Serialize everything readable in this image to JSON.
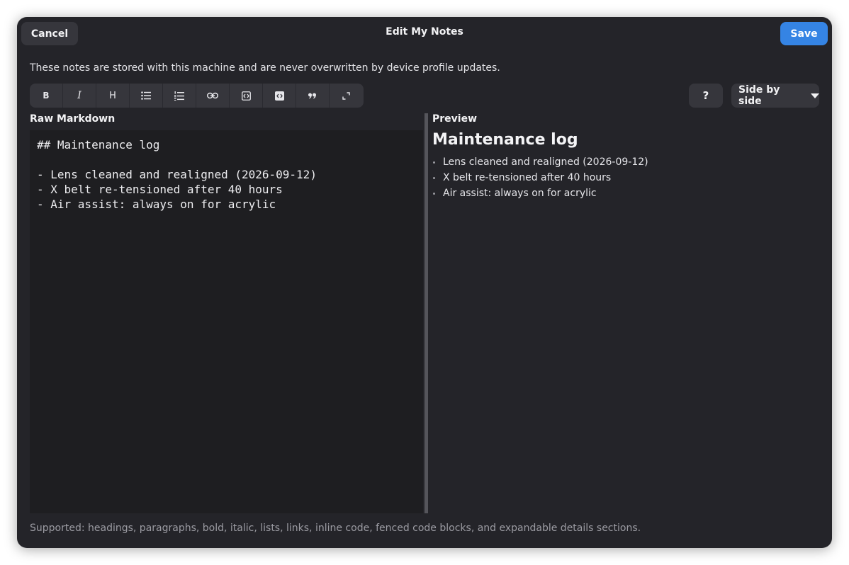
{
  "header": {
    "cancel_label": "Cancel",
    "title": "Edit My Notes",
    "save_label": "Save"
  },
  "description": "These notes are stored with this machine and are never overwritten by device profile updates.",
  "toolbar": {
    "buttons": [
      {
        "icon": "bold-icon",
        "glyph": "B"
      },
      {
        "icon": "italic-icon",
        "glyph": "I"
      },
      {
        "icon": "heading-icon",
        "glyph": "H"
      },
      {
        "icon": "bulleted-list-icon"
      },
      {
        "icon": "numbered-list-icon"
      },
      {
        "icon": "link-icon"
      },
      {
        "icon": "inline-code-icon"
      },
      {
        "icon": "code-block-icon"
      },
      {
        "icon": "quote-icon"
      },
      {
        "icon": "expand-icon"
      }
    ],
    "help_label": "?",
    "view_mode": "Side by side"
  },
  "editor": {
    "label": "Raw Markdown",
    "content": "## Maintenance log\n\n- Lens cleaned and realigned (2026-09-12)\n- X belt re-tensioned after 40 hours\n- Air assist: always on for acrylic"
  },
  "preview": {
    "label": "Preview",
    "heading": "Maintenance log",
    "items": [
      "Lens cleaned and realigned (2026-09-12)",
      "X belt re-tensioned after 40 hours",
      "Air assist: always on for acrylic"
    ]
  },
  "footer": "Supported: headings, paragraphs, bold, italic, lists, links, inline code, fenced code blocks, and expandable details sections.",
  "colors": {
    "background": "#242429",
    "accent": "#3584e4",
    "button": "#36363c",
    "editor_bg": "#1e1e21"
  }
}
